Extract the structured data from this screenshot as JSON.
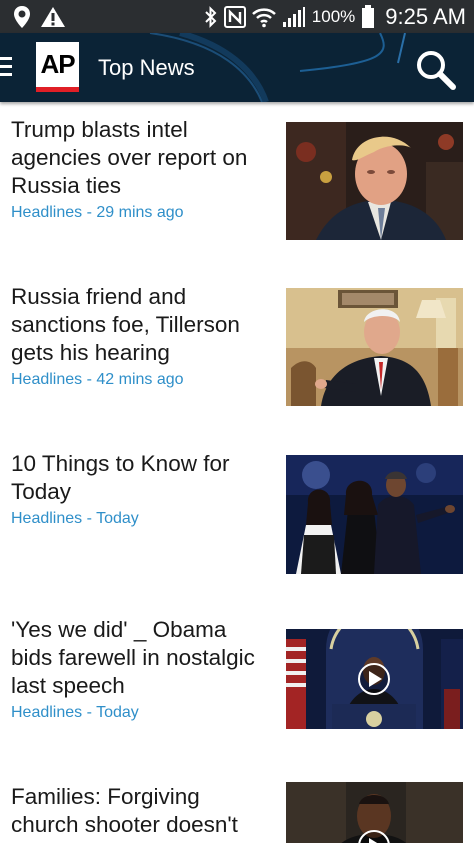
{
  "status_bar": {
    "battery_pct": "100%",
    "time": "9:25 AM",
    "icons": [
      "location-icon",
      "alert-icon",
      "bluetooth-icon",
      "nfc-icon",
      "wifi-icon",
      "signal-icon",
      "battery-icon"
    ]
  },
  "app_bar": {
    "logo_text": "AP",
    "title": "Top News",
    "colors": {
      "bar": "#0b2336",
      "logo_red": "#e01f26",
      "meta_blue": "#2f8fc9"
    }
  },
  "feed": {
    "items": [
      {
        "headline": "Trump blasts intel agencies over report on Russia ties",
        "meta": "Headlines - 29 mins ago"
      },
      {
        "headline": "Russia friend and sanctions foe, Tillerson gets his hearing",
        "meta": "Headlines - 42 mins ago"
      },
      {
        "headline": "10 Things to Know for Today",
        "meta": "Headlines - Today"
      },
      {
        "headline": "'Yes we did' _ Obama bids farewell in nostalgic last speech",
        "meta": "Headlines - Today"
      },
      {
        "headline": "Families: Forgiving church shooter doesn't",
        "meta": ""
      }
    ]
  }
}
